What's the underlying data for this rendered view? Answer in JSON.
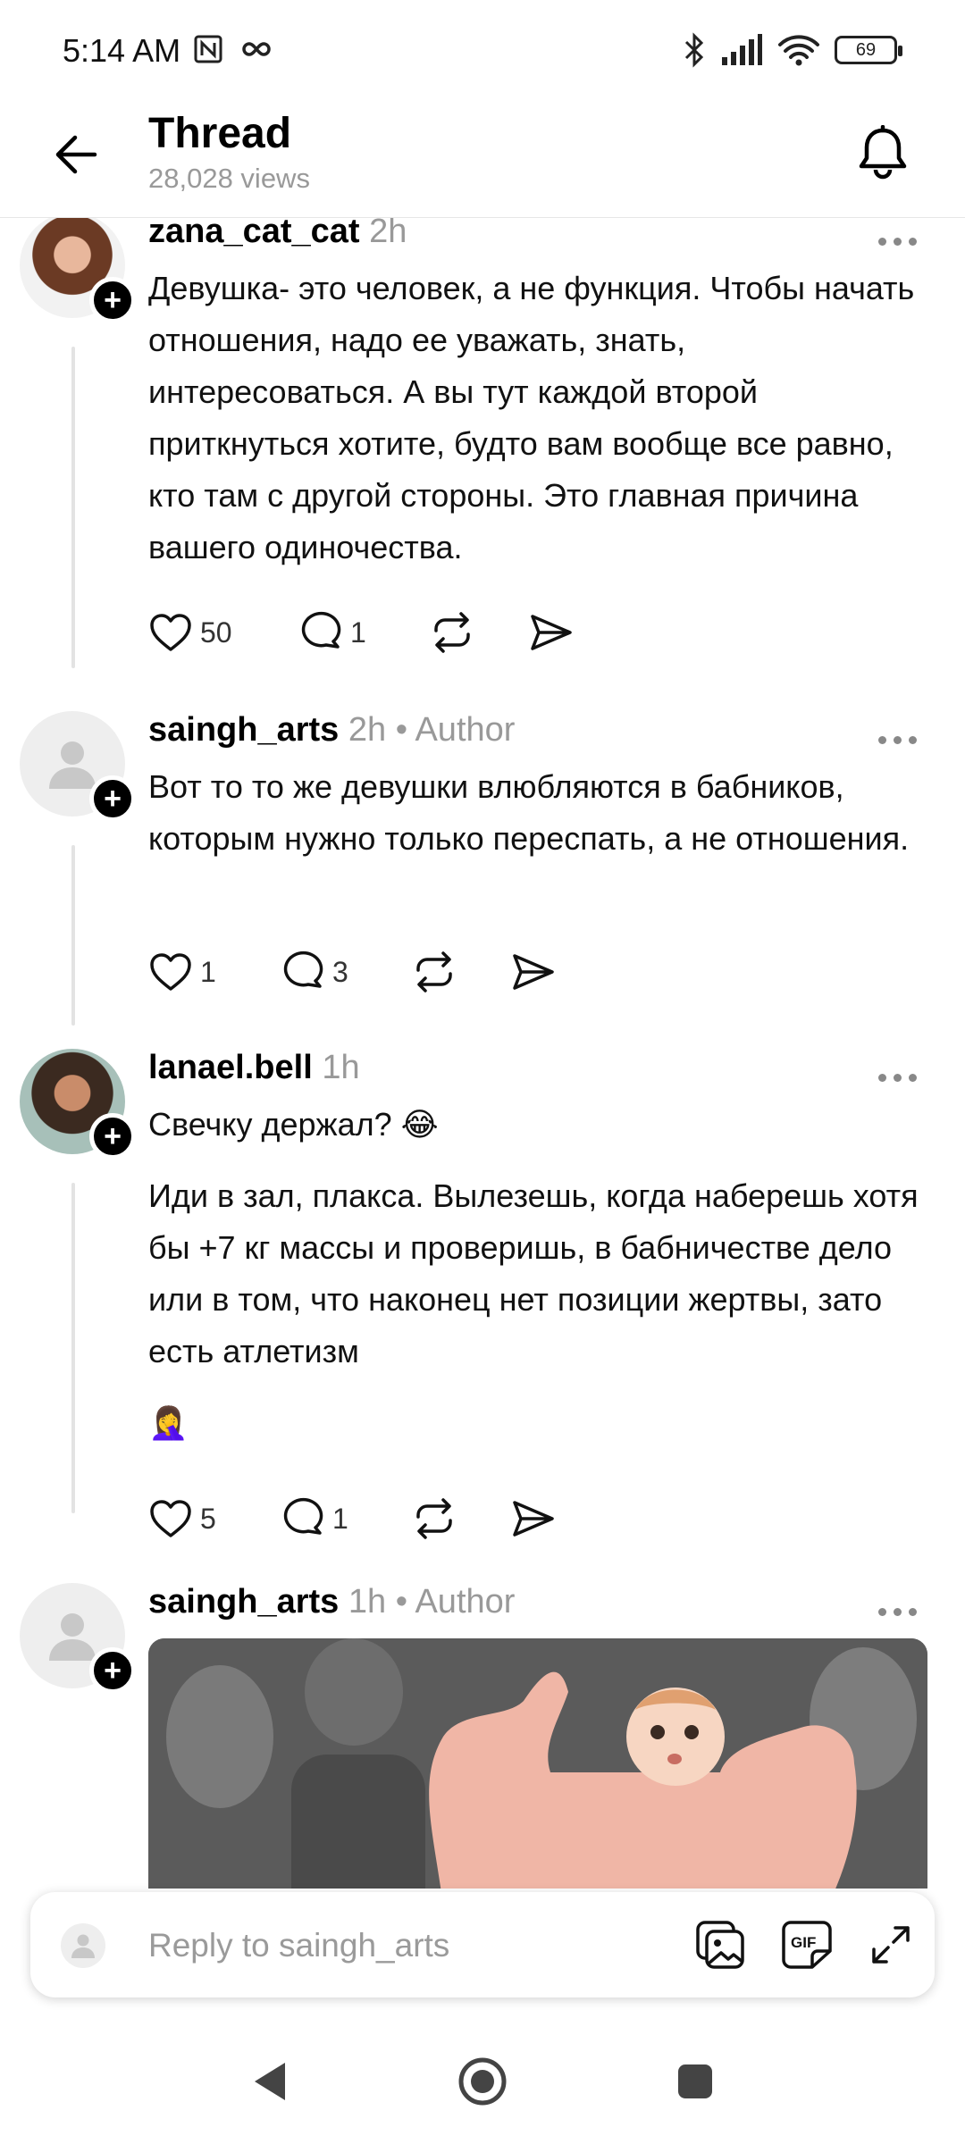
{
  "status_bar": {
    "time": "5:14 AM",
    "battery": "69"
  },
  "header": {
    "title": "Thread",
    "views": "28,028 views"
  },
  "posts": [
    {
      "username": "zana_cat_cat",
      "meta": "2h",
      "text": "Девушка- это человек, а не функция. Чтобы начать отношения, надо ее уважать, знать, интересоваться. А вы тут каждой второй приткнуться хотите, будто вам вообще все равно, кто там с другой стороны. Это главная причина вашего одиночества.",
      "likes": "50",
      "replies": "1"
    },
    {
      "username": "saingh_arts",
      "meta": "2h • Author",
      "text": "Вот то то же девушки влюбляются в бабников, которым нужно только переспать, а не отношения.",
      "likes": "1",
      "replies": "3"
    },
    {
      "username": "lanael.bell",
      "meta": "1h",
      "text": "Свечку держал? 😂",
      "text2": "Иди в зал, плакса. Вылезешь, когда наберешь хотя бы +7 кг массы и проверишь, в бабничестве дело или в том, что наконец нет позиции жертвы, зато есть атлетизм",
      "emoji": "🤦‍♀️",
      "likes": "5",
      "replies": "1"
    },
    {
      "username": "saingh_arts",
      "meta": "1h • Author"
    }
  ],
  "reply_bar": {
    "placeholder": "Reply to saingh_arts"
  },
  "icons": {
    "back": "arrow-left-icon",
    "notifications": "bell-icon",
    "like": "heart-icon",
    "reply": "speech-bubble-icon",
    "repost": "repost-icon",
    "share": "send-icon",
    "image": "image-icon",
    "gif": "gif-icon",
    "expand": "expand-icon"
  }
}
